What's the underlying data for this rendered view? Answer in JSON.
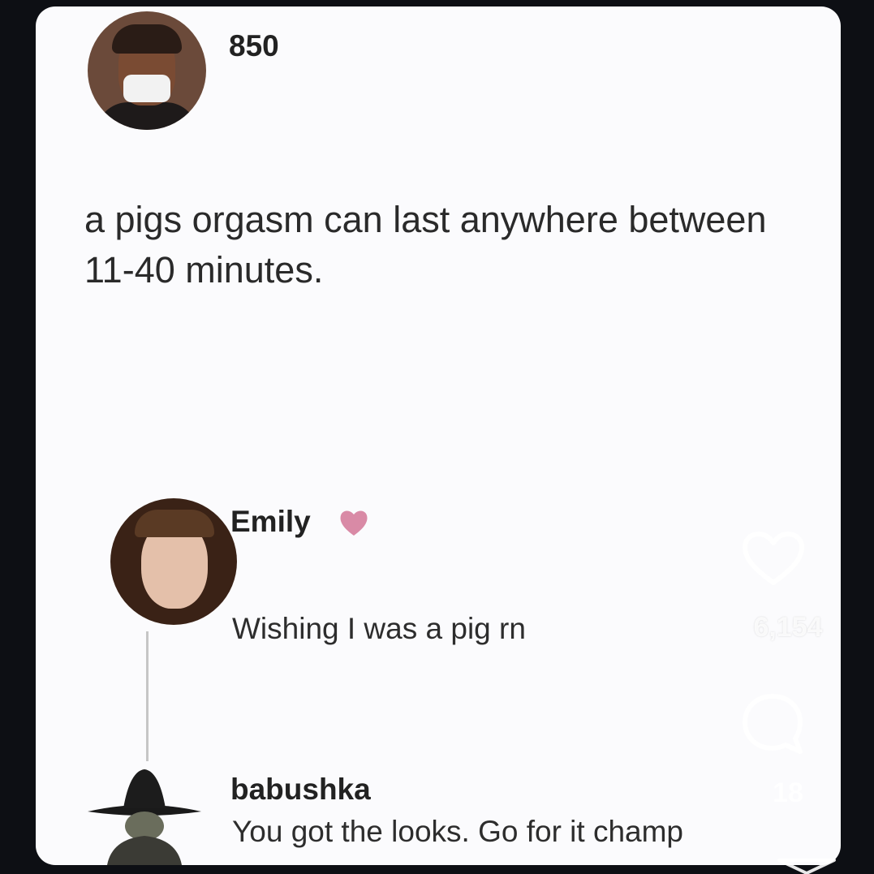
{
  "post": {
    "username": "850",
    "text": "a pigs orgasm can last anywhere between 11-40 minutes."
  },
  "comments": [
    {
      "username": "Emily",
      "badge": "pink-heart-emoji",
      "text": "Wishing I was a pig rn"
    },
    {
      "username": "babushka",
      "text": "You got the looks. Go for it champ"
    }
  ],
  "actions": {
    "likes": "6,154",
    "comments": "18"
  },
  "icons": {
    "like": "heart-outline-icon",
    "comment": "speech-bubble-icon",
    "share": "paper-plane-icon"
  },
  "colors": {
    "background": "#0d0f14",
    "card": "#fbfbfd",
    "heart_emoji": "#d98aa6"
  }
}
